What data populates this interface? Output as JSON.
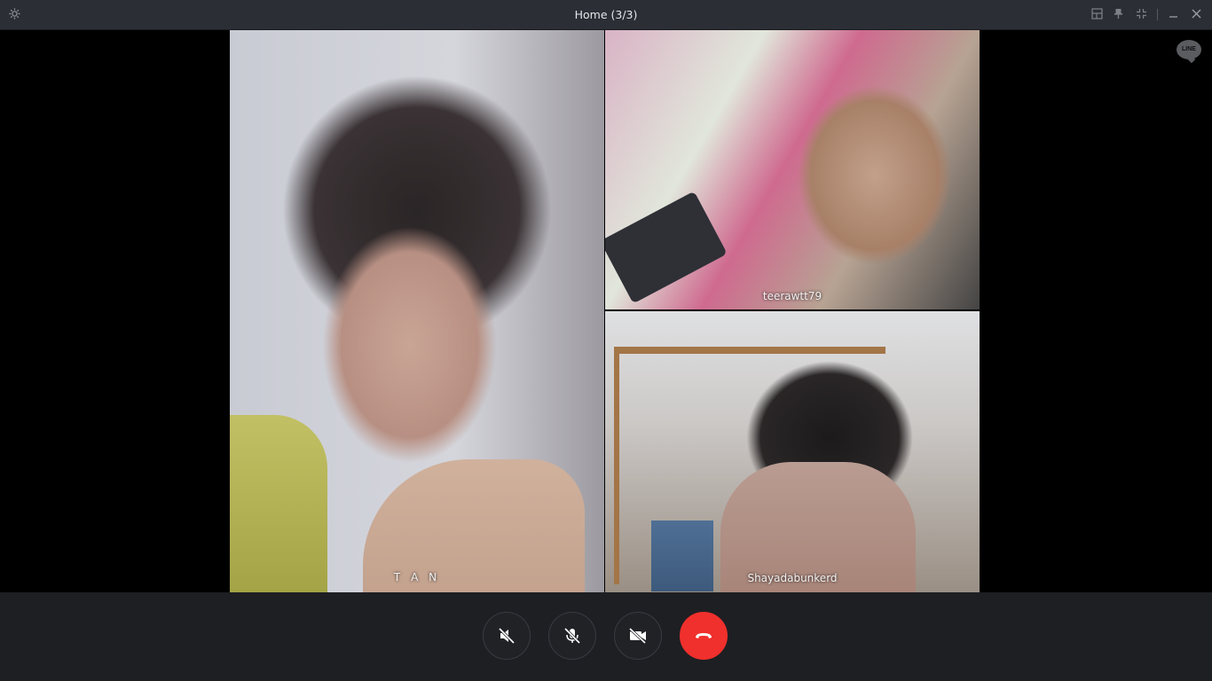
{
  "window": {
    "title": "Home (3/3)",
    "icons": [
      "settings-icon",
      "layout-icon",
      "pin-icon",
      "shrink-icon",
      "minimize-icon",
      "close-icon"
    ]
  },
  "participants": [
    {
      "name": "T A N"
    },
    {
      "name": "teerawtt79"
    },
    {
      "name": "Shayadabunkerd"
    }
  ],
  "logo": {
    "text": "LINE"
  },
  "controls": {
    "speaker": {
      "icon": "speaker-muted-icon",
      "state": "off"
    },
    "mic": {
      "icon": "mic-muted-icon",
      "state": "off"
    },
    "video": {
      "icon": "video-off-icon",
      "state": "off"
    },
    "end_call": {
      "icon": "hang-up-icon"
    }
  },
  "colors": {
    "titlebar": "#2b2e35",
    "control_bar": "#1e1f23",
    "end_call": "#f0302c"
  }
}
